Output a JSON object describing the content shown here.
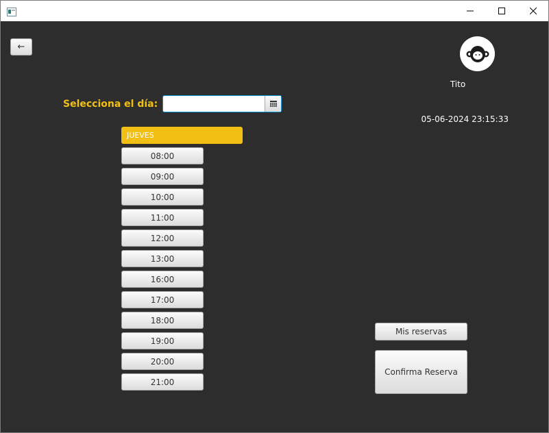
{
  "window": {
    "title": ""
  },
  "header": {
    "back_label": "←",
    "username": "Tito",
    "datetime": "05-06-2024 23:15:33"
  },
  "date_picker": {
    "label": "Selecciona el día:",
    "value": "",
    "placeholder": ""
  },
  "schedule": {
    "day": "JUEVES",
    "slots": [
      "08:00",
      "09:00",
      "10:00",
      "11:00",
      "12:00",
      "13:00",
      "16:00",
      "17:00",
      "18:00",
      "19:00",
      "20:00",
      "21:00"
    ]
  },
  "actions": {
    "my_bookings_label": "Mis reservas",
    "confirm_label": "Confirma Reserva"
  },
  "colors": {
    "background": "#2d2d2d",
    "accent": "#f2c014",
    "focus": "#0f96d6"
  }
}
